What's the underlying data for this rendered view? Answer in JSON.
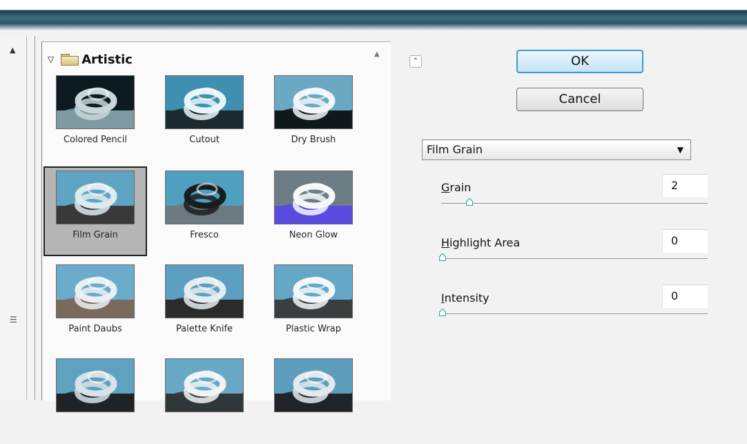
{
  "filter_gallery": {
    "category": "Artistic",
    "filters": [
      {
        "name": "Colored Pencil",
        "selected": false
      },
      {
        "name": "Cutout",
        "selected": false
      },
      {
        "name": "Dry Brush",
        "selected": false
      },
      {
        "name": "Film Grain",
        "selected": true
      },
      {
        "name": "Fresco",
        "selected": false
      },
      {
        "name": "Neon Glow",
        "selected": false
      },
      {
        "name": "Paint Daubs",
        "selected": false
      },
      {
        "name": "Palette Knife",
        "selected": false
      },
      {
        "name": "Plastic Wrap",
        "selected": false
      },
      {
        "name": "",
        "selected": false
      },
      {
        "name": "",
        "selected": false
      },
      {
        "name": "",
        "selected": false
      }
    ]
  },
  "buttons": {
    "ok": "OK",
    "cancel": "Cancel"
  },
  "settings": {
    "selected_filter": "Film Grain",
    "params": [
      {
        "name": "Grain",
        "mnemonic": "G",
        "rest": "rain",
        "value": "2",
        "slider_fraction": 0.1
      },
      {
        "name": "Highlight Area",
        "mnemonic": "H",
        "rest": "ighlight Area",
        "value": "0",
        "slider_fraction": 0.0
      },
      {
        "name": "Intensity",
        "mnemonic": "I",
        "rest": "ntensity",
        "value": "0",
        "slider_fraction": 0.0
      }
    ]
  },
  "colors": {
    "accent": "#3c9ad6",
    "selection_bg": "#b5b5b5",
    "slider_knob": "#3aa6a0"
  },
  "icons": {
    "collapse": "double-chevron-up-icon",
    "expand_group": "triangle-down-icon",
    "folder": "folder-icon",
    "dropdown": "chevron-down-icon"
  }
}
